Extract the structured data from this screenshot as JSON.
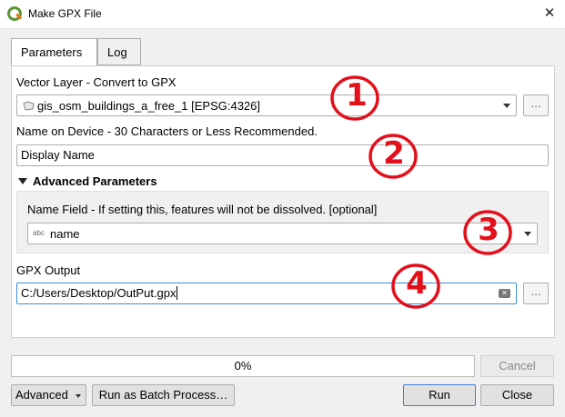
{
  "window": {
    "title": "Make GPX File"
  },
  "tabs": [
    {
      "label": "Parameters"
    },
    {
      "label": "Log"
    }
  ],
  "form": {
    "vector_layer_label": "Vector Layer - Convert to GPX",
    "vector_layer_value": "gis_osm_buildings_a_free_1 [EPSG:4326]",
    "name_label": "Name on Device - 30 Characters or Less Recommended.",
    "name_value": "Display Name",
    "advanced_header": "Advanced Parameters",
    "name_field_label": "Name Field - If setting this, features will not be dissolved. [optional]",
    "name_field_type": "abc",
    "name_field_value": "name",
    "gpx_output_label": "GPX Output",
    "gpx_output_value": "C:/Users/Desktop/OutPut.gpx",
    "browse_label": "…"
  },
  "progress": {
    "text": "0%",
    "value": 0
  },
  "buttons": {
    "cancel": "Cancel",
    "advanced": "Advanced",
    "batch": "Run as Batch Process…",
    "run": "Run",
    "close": "Close"
  },
  "annotations": [
    "1",
    "2",
    "3",
    "4"
  ],
  "colors": {
    "annotation": "#e3101b",
    "focus": "#3a8fdc",
    "qgis_green": "#589632"
  }
}
